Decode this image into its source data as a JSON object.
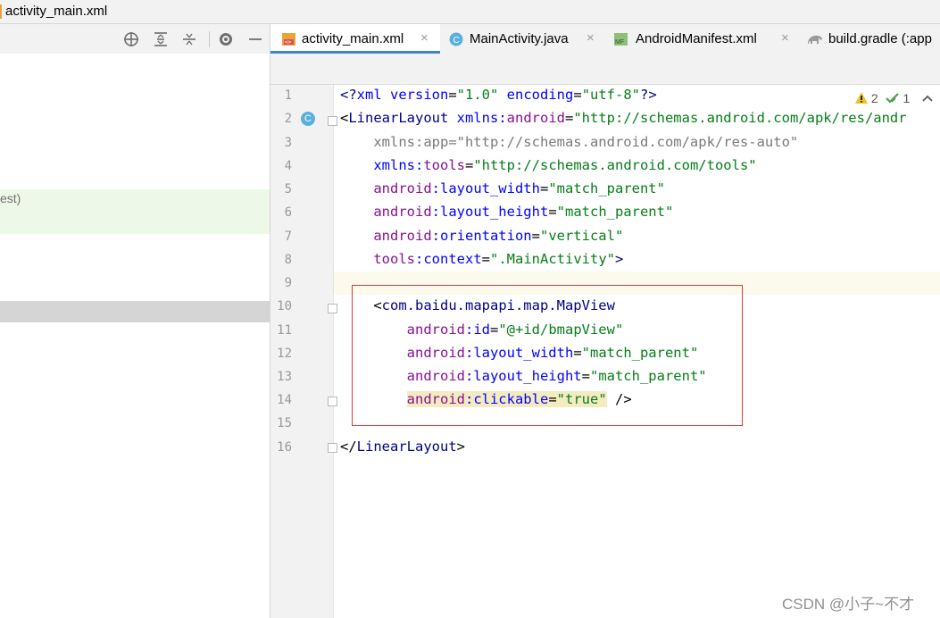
{
  "breadcrumb": {
    "file": "activity_main.xml"
  },
  "left_panel": {
    "toolbar_icons": [
      "crosshair-icon",
      "expand-all-icon",
      "collapse-all-icon",
      "gear-icon",
      "minimize-icon"
    ],
    "partial_label": "est)"
  },
  "tabs": [
    {
      "label": "activity_main.xml",
      "icon": "xml-file-icon",
      "active": true,
      "closable": true
    },
    {
      "label": "MainActivity.java",
      "icon": "java-class-icon",
      "active": false,
      "closable": true
    },
    {
      "label": "AndroidManifest.xml",
      "icon": "manifest-icon",
      "active": false,
      "closable": true
    },
    {
      "label": "build.gradle (:app",
      "icon": "gradle-icon",
      "active": false,
      "closable": false
    }
  ],
  "inspections": {
    "warnings": "2",
    "ok": "1"
  },
  "lines": [
    {
      "n": "1"
    },
    {
      "n": "2"
    },
    {
      "n": "3"
    },
    {
      "n": "4"
    },
    {
      "n": "5"
    },
    {
      "n": "6"
    },
    {
      "n": "7"
    },
    {
      "n": "8"
    },
    {
      "n": "9"
    },
    {
      "n": "10"
    },
    {
      "n": "11"
    },
    {
      "n": "12"
    },
    {
      "n": "13"
    },
    {
      "n": "14"
    },
    {
      "n": "15"
    },
    {
      "n": "16"
    }
  ],
  "code": {
    "l1": {
      "a": "<?",
      "b": "xml version",
      "c": "=",
      "d": "\"1.0\"",
      "e": " encoding",
      "f": "=",
      "g": "\"utf-8\"",
      "h": "?>"
    },
    "l2": {
      "a": "<",
      "b": "LinearLayout",
      "c": " xmlns:",
      "d": "android",
      "e": "=",
      "f": "\"http://schemas.android.com/apk/res/andr"
    },
    "l3": {
      "a": "    xmlns:app=\"http://schemas.android.com/apk/res-auto\""
    },
    "l4": {
      "a": "    xmlns:",
      "b": "tools",
      "c": "=",
      "d": "\"http://schemas.android.com/tools\""
    },
    "l5": {
      "a": "    ",
      "b": "android",
      "c": ":layout_width",
      "d": "=",
      "e": "\"match_parent\""
    },
    "l6": {
      "a": "    ",
      "b": "android",
      "c": ":layout_height",
      "d": "=",
      "e": "\"match_parent\""
    },
    "l7": {
      "a": "    ",
      "b": "android",
      "c": ":orientation",
      "d": "=",
      "e": "\"vertical\""
    },
    "l8": {
      "a": "    ",
      "b": "tools",
      "c": ":context",
      "d": "=",
      "e": "\".MainActivity\"",
      "f": ">"
    },
    "l10": {
      "a": "    <",
      "b": "com.baidu.mapapi.map.MapView"
    },
    "l11": {
      "a": "        ",
      "b": "android",
      "c": ":id",
      "d": "=",
      "e": "\"@+id/bmapView\""
    },
    "l12": {
      "a": "        ",
      "b": "android",
      "c": ":layout_width",
      "d": "=",
      "e": "\"match_parent\""
    },
    "l13": {
      "a": "        ",
      "b": "android",
      "c": ":layout_height",
      "d": "=",
      "e": "\"match_parent\""
    },
    "l14": {
      "a": "        ",
      "b": "android",
      "c": ":clickable",
      "d": "=",
      "e": "\"true\"",
      "f": " />"
    },
    "l16": {
      "a": "</",
      "b": "LinearLayout",
      "c": ">"
    }
  },
  "gutter_marker": "C",
  "watermark": "CSDN @小子~不才"
}
